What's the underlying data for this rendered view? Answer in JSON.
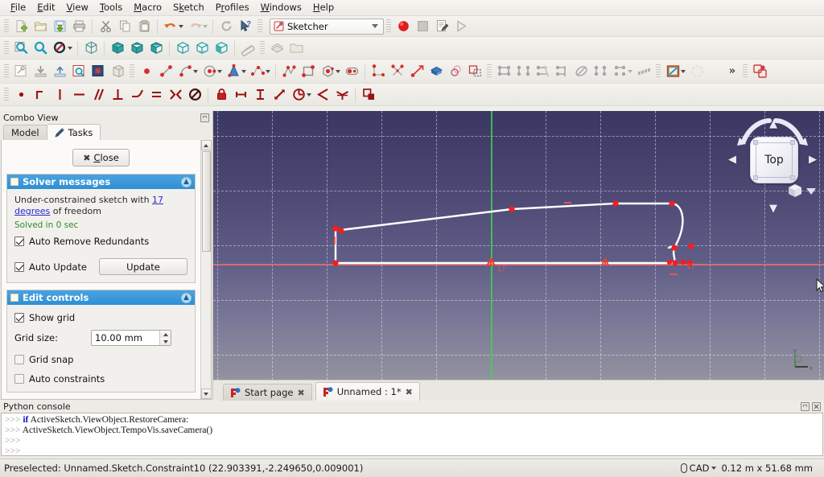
{
  "window": {
    "app": "FreeCAD",
    "workbench": "Sketcher"
  },
  "menubar": {
    "items": [
      {
        "label": "File",
        "mnemonic": "F"
      },
      {
        "label": "Edit",
        "mnemonic": "E"
      },
      {
        "label": "View",
        "mnemonic": "V"
      },
      {
        "label": "Tools",
        "mnemonic": "T"
      },
      {
        "label": "Macro",
        "mnemonic": "M"
      },
      {
        "label": "Sketch",
        "mnemonic": "k"
      },
      {
        "label": "Profiles",
        "mnemonic": "r"
      },
      {
        "label": "Windows",
        "mnemonic": "W"
      },
      {
        "label": "Help",
        "mnemonic": "H"
      }
    ]
  },
  "toolbars": {
    "file": {
      "buttons": [
        {
          "name": "new-document-icon",
          "tip": "New"
        },
        {
          "name": "open-document-icon",
          "tip": "Open"
        },
        {
          "name": "save-document-icon",
          "tip": "Save"
        },
        {
          "name": "print-document-icon",
          "tip": "Print"
        },
        {
          "name": "cut-icon",
          "tip": "Cut"
        },
        {
          "name": "copy-icon",
          "tip": "Copy"
        },
        {
          "name": "paste-icon",
          "tip": "Paste"
        },
        {
          "name": "undo-icon",
          "tip": "Undo"
        },
        {
          "name": "redo-icon",
          "tip": "Redo"
        },
        {
          "name": "refresh-icon",
          "tip": "Refresh"
        },
        {
          "name": "whats-this-icon",
          "tip": "What's This?"
        }
      ]
    },
    "macro": {
      "buttons": [
        {
          "name": "macro-record-icon",
          "tip": "Macro recording"
        },
        {
          "name": "macro-stop-icon",
          "tip": "Stop macro recording"
        },
        {
          "name": "macro-edit-icon",
          "tip": "Macros"
        },
        {
          "name": "macro-execute-icon",
          "tip": "Execute macro"
        }
      ]
    },
    "view": {
      "buttons": [
        {
          "name": "fit-all-icon",
          "tip": "Fit all"
        },
        {
          "name": "fit-selection-icon",
          "tip": "Fit selection"
        },
        {
          "name": "draw-style-icon",
          "tip": "Draw style"
        },
        {
          "name": "isometric-view-icon",
          "tip": "Isometric"
        },
        {
          "name": "front-view-icon",
          "tip": "Front"
        },
        {
          "name": "top-view-icon",
          "tip": "Top"
        },
        {
          "name": "right-view-icon",
          "tip": "Right"
        },
        {
          "name": "rear-view-icon",
          "tip": "Rear"
        },
        {
          "name": "bottom-view-icon",
          "tip": "Bottom"
        },
        {
          "name": "left-view-icon",
          "tip": "Left"
        },
        {
          "name": "measure-icon",
          "tip": "Measure"
        },
        {
          "name": "workbench-icon",
          "tip": "Workbench"
        },
        {
          "name": "folder-icon",
          "tip": "Folder"
        }
      ]
    },
    "sketcher": {
      "buttons": [
        {
          "name": "create-sketch-icon",
          "tip": "Create sketch"
        },
        {
          "name": "edit-sketch-icon",
          "tip": "Edit sketch"
        },
        {
          "name": "leave-sketch-icon",
          "tip": "Leave sketch"
        },
        {
          "name": "view-sketch-icon",
          "tip": "View sketch"
        },
        {
          "name": "view-section-icon",
          "tip": "View section"
        },
        {
          "name": "map-sketch-icon",
          "tip": "Map sketch to face"
        },
        {
          "name": "point-icon",
          "tip": "Create point"
        },
        {
          "name": "line-icon",
          "tip": "Create line"
        },
        {
          "name": "arc-icon",
          "tip": "Create arc"
        },
        {
          "name": "circle-icon",
          "tip": "Create circle"
        },
        {
          "name": "conic-icon",
          "tip": "Create conic"
        },
        {
          "name": "bspline-icon",
          "tip": "Create B-spline"
        },
        {
          "name": "polyline-icon",
          "tip": "Create polyline"
        },
        {
          "name": "rectangle-icon",
          "tip": "Create rectangle"
        },
        {
          "name": "polygon-icon",
          "tip": "Create regular polygon"
        },
        {
          "name": "slot-icon",
          "tip": "Create slot"
        },
        {
          "name": "fillet-icon",
          "tip": "Create fillet"
        },
        {
          "name": "trim-icon",
          "tip": "Trim edge"
        },
        {
          "name": "extend-icon",
          "tip": "Extend edge"
        },
        {
          "name": "external-geometry-icon",
          "tip": "External geometry"
        },
        {
          "name": "carbon-copy-icon",
          "tip": "Carbon copy"
        },
        {
          "name": "construction-mode-icon",
          "tip": "Toggle construction geometry"
        },
        {
          "name": "select-constraints-icon",
          "tip": "Select constraints"
        },
        {
          "name": "select-origin-icon",
          "tip": "Select origin"
        },
        {
          "name": "select-conflicting-icon",
          "tip": "Select conflicting constraints"
        },
        {
          "name": "select-redundant-icon",
          "tip": "Select redundant constraints"
        },
        {
          "name": "select-elements-icon",
          "tip": "Select elements"
        },
        {
          "name": "clone-icon",
          "tip": "Clone"
        },
        {
          "name": "symmetry-icon",
          "tip": "Symmetry"
        },
        {
          "name": "rectangular-array-icon",
          "tip": "Rectangular array"
        },
        {
          "name": "validate-sketch-icon",
          "tip": "Validate sketch"
        },
        {
          "name": "sketcher-visual-icon",
          "tip": "Visual sketch"
        },
        {
          "name": "overflow-icon",
          "tip": "More"
        },
        {
          "name": "sketcher-tools-icon",
          "tip": "Sketcher tools"
        }
      ],
      "overflow_label": "»"
    },
    "constraints": {
      "buttons": [
        {
          "name": "constrain-coincident-icon",
          "tip": "Constrain coincident"
        },
        {
          "name": "constrain-point-on-object-icon",
          "tip": "Constrain point onto object"
        },
        {
          "name": "constrain-vertical-icon",
          "tip": "Constrain vertical"
        },
        {
          "name": "constrain-horizontal-icon",
          "tip": "Constrain horizontal"
        },
        {
          "name": "constrain-parallel-icon",
          "tip": "Constrain parallel"
        },
        {
          "name": "constrain-perpendicular-icon",
          "tip": "Constrain perpendicular"
        },
        {
          "name": "constrain-tangent-icon",
          "tip": "Constrain tangent"
        },
        {
          "name": "constrain-equal-icon",
          "tip": "Constrain equal"
        },
        {
          "name": "constrain-symmetric-icon",
          "tip": "Constrain symmetric"
        },
        {
          "name": "constrain-block-icon",
          "tip": "Constrain block"
        },
        {
          "name": "constrain-lock-icon",
          "tip": "Constrain lock"
        },
        {
          "name": "constrain-distance-x-icon",
          "tip": "Constrain horizontal distance"
        },
        {
          "name": "constrain-distance-y-icon",
          "tip": "Constrain vertical distance"
        },
        {
          "name": "constrain-distance-icon",
          "tip": "Constrain distance"
        },
        {
          "name": "constrain-radius-icon",
          "tip": "Constrain radius"
        },
        {
          "name": "constrain-angle-icon",
          "tip": "Constrain angle"
        },
        {
          "name": "constrain-snells-law-icon",
          "tip": "Constrain refraction (Snell's law)"
        },
        {
          "name": "toggle-driving-constraint-icon",
          "tip": "Toggle driving/reference constraint"
        }
      ]
    }
  },
  "combo_view": {
    "title": "Combo View",
    "float_icon": "undock-icon",
    "tabs": [
      {
        "label": "Model",
        "active": false
      },
      {
        "label": "Tasks",
        "active": true
      }
    ],
    "close_button": "Close",
    "solver": {
      "title": "Solver messages",
      "message_prefix": "Under-constrained sketch with ",
      "message_link": "17 degrees",
      "message_suffix": " of freedom",
      "solved": "Solved in 0 sec",
      "auto_remove_redundants": {
        "label": "Auto Remove Redundants",
        "checked": true
      },
      "auto_update": {
        "label": "Auto Update",
        "checked": true
      },
      "update_button": "Update"
    },
    "edit_controls": {
      "title": "Edit controls",
      "show_grid": {
        "label": "Show grid",
        "checked": true
      },
      "grid_size": {
        "label": "Grid size:",
        "value": "10.00 mm"
      },
      "grid_snap": {
        "label": "Grid snap",
        "checked": false
      },
      "auto_constraints": {
        "label": "Auto constraints",
        "checked": false
      }
    }
  },
  "viewport": {
    "navigation_cube": {
      "face_label": "Top",
      "arrows": [
        "up",
        "down",
        "left",
        "right"
      ]
    },
    "axis_indicator": {
      "x": "x",
      "y": "y",
      "z": "z"
    },
    "origin_axis_colors": {
      "x": "#e8706e",
      "y": "#3ad14a"
    },
    "background_top": "#3b3763",
    "background_bottom": "#93929f",
    "geometry_color": "#ffffff",
    "point_color": "#ff1a1a",
    "constraint_label": "17"
  },
  "view_tabs": [
    {
      "label": "Start page",
      "active": false,
      "close": "✖"
    },
    {
      "label": "Unnamed : 1*",
      "active": true,
      "close": "✖"
    }
  ],
  "python_console": {
    "title": "Python console",
    "float_icon": "undock-icon",
    "close_icon": "close-icon",
    "lines": [
      {
        "prompt": ">>>",
        "keyword": "if",
        "text": " ActiveSketch.ViewObject.RestoreCamera:"
      },
      {
        "prompt": ">>>",
        "keyword": "",
        "text": "   ActiveSketch.ViewObject.TempoVis.saveCamera()"
      },
      {
        "prompt": ">>>",
        "keyword": "",
        "text": ""
      },
      {
        "prompt": ">>>",
        "keyword": "",
        "text": ""
      }
    ]
  },
  "statusbar": {
    "message": "Preselected: Unnamed.Sketch.Constraint10 (22.903391,-2.249650,0.009001)",
    "unit_system": "CAD",
    "dimensions": "0.12 m x 51.68 mm"
  }
}
